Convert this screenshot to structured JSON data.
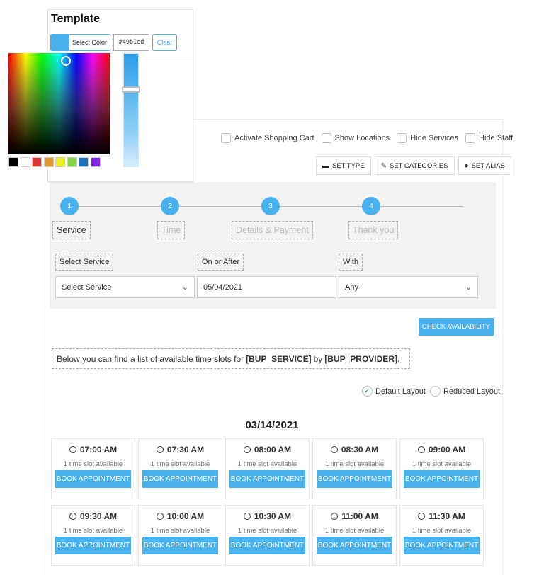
{
  "toggles": [
    {
      "label": "Activate Shopping Cart"
    },
    {
      "label": "Show Locations"
    },
    {
      "label": "Hide Services"
    },
    {
      "label": "Hide Staff"
    }
  ],
  "set_buttons": [
    {
      "label": "SET TYPE",
      "icon": "bed-icon"
    },
    {
      "label": "SET CATEGORIES",
      "icon": "edit-icon"
    },
    {
      "label": "SET ALIAS",
      "icon": "user-secret-icon"
    }
  ],
  "steps": [
    {
      "number": "1",
      "label": "Service"
    },
    {
      "number": "2",
      "label": "Time"
    },
    {
      "number": "3",
      "label": "Details & Payment"
    },
    {
      "number": "4",
      "label": "Thank you"
    }
  ],
  "fields": {
    "service_label": "Select Service",
    "service_value": "Select Service",
    "date_label": "On or After",
    "date_value": "05/04/2021",
    "with_label": "With",
    "with_value": "Any"
  },
  "check_availability": "CHECK AVAILABILITY",
  "note": {
    "prefix": "Below you can find a list of available time slots for",
    "service": "[BUP_SERVICE]",
    "mid": "by",
    "provider": "[BUP_PROVIDER]",
    "suffix": "."
  },
  "layout_options": {
    "default": "Default Layout",
    "reduced": "Reduced Layout",
    "selected": "Default Layout"
  },
  "date": "03/14/2021",
  "slots": [
    {
      "time": "07:00 AM",
      "available": "1 time slot available",
      "button": "BOOK APPOINTMENT"
    },
    {
      "time": "07:30 AM",
      "available": "1 time slot available",
      "button": "BOOK APPOINTMENT"
    },
    {
      "time": "08:00 AM",
      "available": "1 time slot available",
      "button": "BOOK APPOINTMENT"
    },
    {
      "time": "08:30 AM",
      "available": "1 time slot available",
      "button": "BOOK APPOINTMENT"
    },
    {
      "time": "09:00 AM",
      "available": "1 time slot available",
      "button": "BOOK APPOINTMENT"
    },
    {
      "time": "09:30 AM",
      "available": "1 time slot available",
      "button": "BOOK APPOINTMENT"
    },
    {
      "time": "10:00 AM",
      "available": "1 time slot available",
      "button": "BOOK APPOINTMENT"
    },
    {
      "time": "10:30 AM",
      "available": "1 time slot available",
      "button": "BOOK APPOINTMENT"
    },
    {
      "time": "11:00 AM",
      "available": "1 time slot available",
      "button": "BOOK APPOINTMENT"
    },
    {
      "time": "11:30 AM",
      "available": "1 time slot available",
      "button": "BOOK APPOINTMENT"
    }
  ],
  "picker": {
    "title": "Template",
    "select_color": "Select Color",
    "hex_value": "#49b1ed",
    "clear": "Clear",
    "current_color": "#49b1ed",
    "swatches": [
      "#000000",
      "#ffffff",
      "#dd3333",
      "#dd9933",
      "#eeee22",
      "#81d742",
      "#1e73be",
      "#8224e3"
    ]
  },
  "colors": {
    "accent": "#49b1ed"
  }
}
